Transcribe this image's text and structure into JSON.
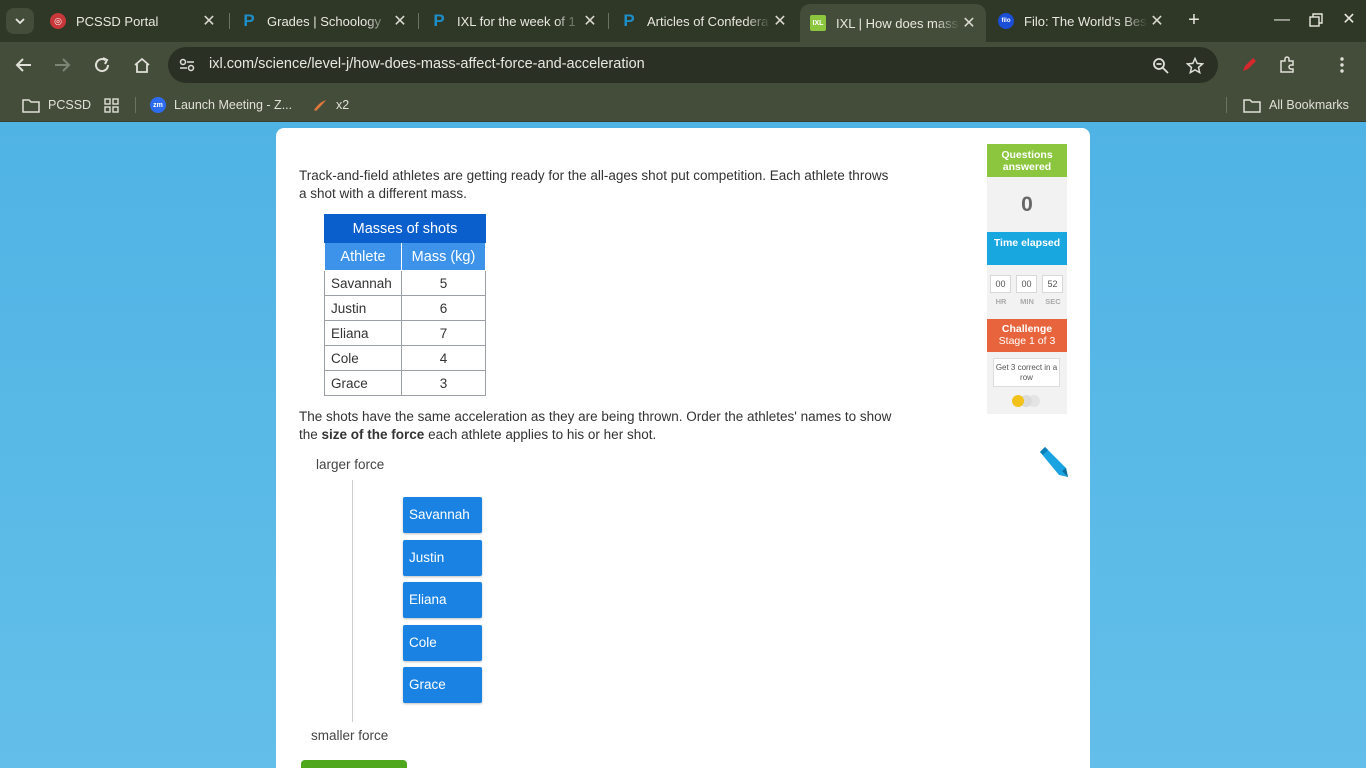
{
  "browser": {
    "tabs": [
      {
        "title": "PCSSD Portal",
        "icon": "pcssd-favicon",
        "active": false
      },
      {
        "title": "Grades | Schoology",
        "icon": "schoology-favicon",
        "active": false
      },
      {
        "title": "IXL for the week of 1",
        "icon": "schoology-favicon",
        "active": false
      },
      {
        "title": "Articles of Confedera",
        "icon": "schoology-favicon",
        "active": false
      },
      {
        "title": "IXL | How does mass",
        "icon": "ixl-favicon",
        "active": true
      },
      {
        "title": "Filo: The World's Bes",
        "icon": "filo-favicon",
        "active": false
      }
    ],
    "url": "ixl.com/science/level-j/how-does-mass-affect-force-and-acceleration",
    "bookmarks": [
      {
        "label": "PCSSD",
        "icon": "folder-icon"
      },
      {
        "label": "",
        "icon": "apps-grid-icon"
      },
      {
        "label": "Launch Meeting - Z...",
        "icon": "zoom-icon"
      },
      {
        "label": "x2",
        "icon": "x2-icon"
      }
    ],
    "all_bookmarks": "All Bookmarks"
  },
  "question": {
    "intro": "Track-and-field athletes are getting ready for the all-ages shot put competition. Each athlete throws a shot with a different mass.",
    "table": {
      "caption": "Masses of shots",
      "headers": [
        "Athlete",
        "Mass (kg)"
      ],
      "rows": [
        {
          "athlete": "Savannah",
          "mass": "5"
        },
        {
          "athlete": "Justin",
          "mass": "6"
        },
        {
          "athlete": "Eliana",
          "mass": "7"
        },
        {
          "athlete": "Cole",
          "mass": "4"
        },
        {
          "athlete": "Grace",
          "mass": "3"
        }
      ]
    },
    "instruction_pre": "The shots have the same acceleration as they are being thrown. Order the athletes' names to show the ",
    "instruction_bold": "size of the force",
    "instruction_post": " each athlete applies to his or her shot.",
    "top_label": "larger force",
    "bottom_label": "smaller force",
    "choices": [
      "Savannah",
      "Justin",
      "Eliana",
      "Cole",
      "Grace"
    ]
  },
  "sidebar": {
    "questions_answered_label": "Questions answered",
    "questions_answered": "0",
    "time_elapsed_label": "Time elapsed",
    "time": {
      "hr": "00",
      "min": "00",
      "sec": "52"
    },
    "time_units": {
      "hr": "HR",
      "min": "MIN",
      "sec": "SEC"
    },
    "challenge_label": "Challenge",
    "challenge_stage": "Stage 1 of 3",
    "challenge_goal": "Get 3 correct in a row",
    "challenge_progress": 1,
    "challenge_total": 3
  },
  "colors": {
    "accent_blue": "#1a82e2",
    "green": "#8cc63f",
    "cyan": "#19a7e0",
    "orange": "#e8643c",
    "background": "#5bb8e6"
  }
}
